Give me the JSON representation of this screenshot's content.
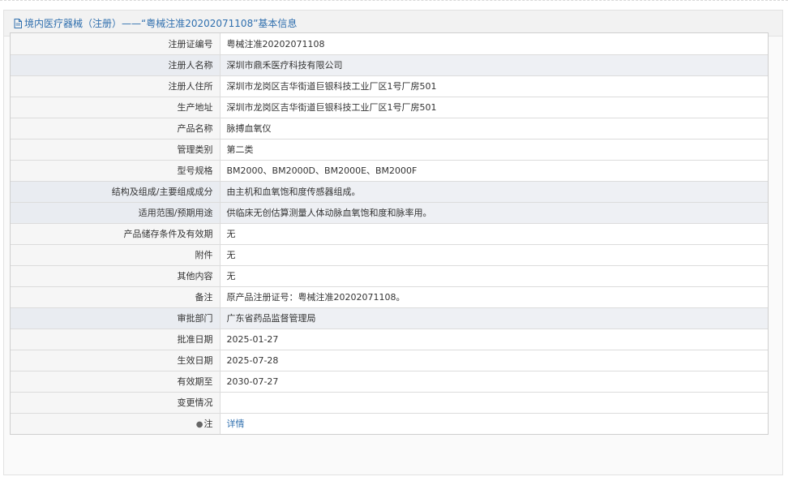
{
  "header": {
    "title": "境内医疗器械（注册）——“粤械注准20202071108”基本信息"
  },
  "rows": [
    {
      "label": "注册证编号",
      "value": "粤械注准20202071108"
    },
    {
      "label": "注册人名称",
      "value": "深圳市鼎禾医疗科技有限公司"
    },
    {
      "label": "注册人住所",
      "value": "深圳市龙岗区吉华街道巨银科技工业厂区1号厂房501"
    },
    {
      "label": "生产地址",
      "value": "深圳市龙岗区吉华街道巨银科技工业厂区1号厂房501"
    },
    {
      "label": "产品名称",
      "value": "脉搏血氧仪"
    },
    {
      "label": "管理类别",
      "value": "第二类"
    },
    {
      "label": "型号规格",
      "value": "BM2000、BM2000D、BM2000E、BM2000F"
    },
    {
      "label": "结构及组成/主要组成成分",
      "value": "由主机和血氧饱和度传感器组成。"
    },
    {
      "label": "适用范围/预期用途",
      "value": "供临床无创估算测量人体动脉血氧饱和度和脉率用。"
    },
    {
      "label": "产品储存条件及有效期",
      "value": "无"
    },
    {
      "label": "附件",
      "value": "无"
    },
    {
      "label": "其他内容",
      "value": "无"
    },
    {
      "label": "备注",
      "value": "原产品注册证号：粤械注准20202071108。"
    },
    {
      "label": "审批部门",
      "value": "广东省药品监督管理局"
    },
    {
      "label": "批准日期",
      "value": "2025-01-27"
    },
    {
      "label": "生效日期",
      "value": "2025-07-28"
    },
    {
      "label": "有效期至",
      "value": "2030-07-27"
    },
    {
      "label": "变更情况",
      "value": ""
    }
  ],
  "note": {
    "icon": "pin-icon",
    "label": "注",
    "link": "详情"
  },
  "colors": {
    "accent": "#2f6fae",
    "highlight_row": "#eef0f4"
  }
}
